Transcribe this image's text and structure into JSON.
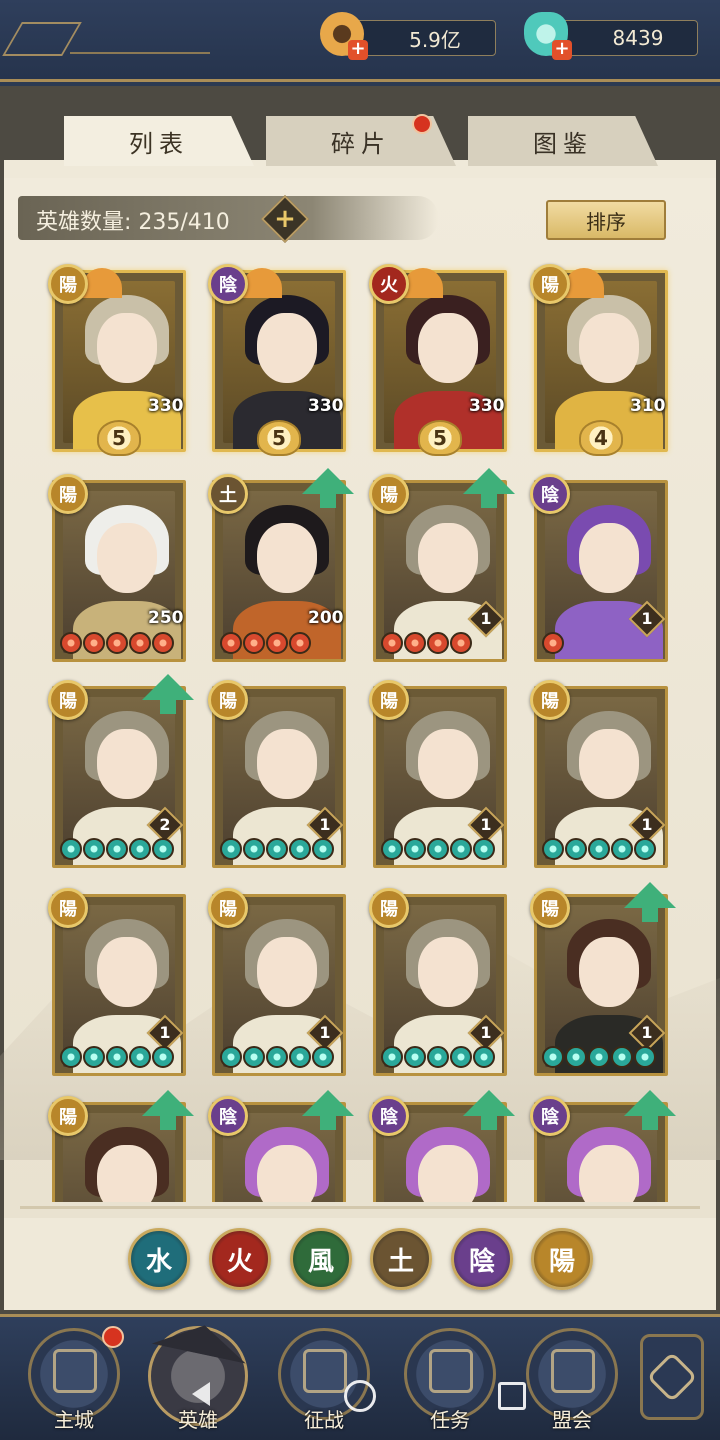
{
  "currencies": [
    {
      "icon": "coin-icon",
      "value": "5.9亿"
    },
    {
      "icon": "jade-pouch-icon",
      "value": "8439"
    }
  ],
  "tabs": [
    {
      "label": "列表",
      "active": true,
      "badge": false
    },
    {
      "label": "碎片",
      "active": false,
      "badge": true
    },
    {
      "label": "图鉴",
      "active": false,
      "badge": false
    }
  ],
  "hero_count": "英雄数量: 235/410",
  "add_label": "+",
  "sort_label": "排序",
  "colors": {
    "yang": "#b8862a",
    "yin": "#6a3f8c",
    "fire": "#a3281e",
    "earth": "#6b5432",
    "water": "#1f6d7a",
    "wind": "#2f6b3a",
    "gem_red": "#d8492e",
    "gem_teal": "#2aa89a",
    "arrow": "#3fb07a"
  },
  "heroes": [
    {
      "element": "陽",
      "badge": "5",
      "level": "330",
      "style": "gold",
      "gems": [],
      "upgrade": false,
      "hair": "#c9c0a8",
      "robe": "#e7c04a"
    },
    {
      "element": "陰",
      "badge": "5",
      "level": "330",
      "style": "gold",
      "gems": [],
      "upgrade": false,
      "hair": "#1c1a24",
      "robe": "#2b2a30"
    },
    {
      "element": "火",
      "badge": "5",
      "level": "330",
      "style": "gold",
      "gems": [],
      "upgrade": false,
      "hair": "#3a2020",
      "robe": "#b0302a"
    },
    {
      "element": "陽",
      "badge": "4",
      "level": "310",
      "style": "gold",
      "gems": [],
      "upgrade": false,
      "hair": "#c9c0a8",
      "robe": "#e0b443"
    },
    {
      "element": "陽",
      "badge": "",
      "level": "250",
      "style": "normal",
      "gems": [
        "red",
        "red",
        "red",
        "red",
        "red"
      ],
      "upgrade": false,
      "hair": "#eeeeea",
      "robe": "#c8b27a"
    },
    {
      "element": "土",
      "badge": "",
      "level": "200",
      "style": "normal",
      "gems": [
        "red",
        "red",
        "red",
        "red"
      ],
      "upgrade": true,
      "hair": "#1e1a1c",
      "robe": "#c0652a"
    },
    {
      "element": "陽",
      "badge": "",
      "level": "1",
      "style": "normal",
      "gems": [
        "red",
        "red",
        "red",
        "red"
      ],
      "upgrade": true,
      "hair": "#9c9580",
      "robe": "#ece6d2"
    },
    {
      "element": "陰",
      "badge": "",
      "level": "1",
      "style": "normal",
      "gems": [
        "red"
      ],
      "upgrade": false,
      "hair": "#7a4bb0",
      "robe": "#8e62c4"
    },
    {
      "element": "陽",
      "badge": "",
      "level": "2",
      "style": "normal",
      "gems": [
        "teal",
        "teal",
        "teal",
        "teal",
        "teal"
      ],
      "upgrade": true,
      "hair": "#9c9580",
      "robe": "#ece6d2"
    },
    {
      "element": "陽",
      "badge": "",
      "level": "1",
      "style": "normal",
      "gems": [
        "teal",
        "teal",
        "teal",
        "teal",
        "teal"
      ],
      "upgrade": false,
      "hair": "#9c9580",
      "robe": "#ece6d2"
    },
    {
      "element": "陽",
      "badge": "",
      "level": "1",
      "style": "normal",
      "gems": [
        "teal",
        "teal",
        "teal",
        "teal",
        "teal"
      ],
      "upgrade": false,
      "hair": "#9c9580",
      "robe": "#ece6d2"
    },
    {
      "element": "陽",
      "badge": "",
      "level": "1",
      "style": "normal",
      "gems": [
        "teal",
        "teal",
        "teal",
        "teal",
        "teal"
      ],
      "upgrade": false,
      "hair": "#9c9580",
      "robe": "#ece6d2"
    },
    {
      "element": "陽",
      "badge": "",
      "level": "1",
      "style": "normal",
      "gems": [
        "teal",
        "teal",
        "teal",
        "teal",
        "teal"
      ],
      "upgrade": false,
      "hair": "#9c9580",
      "robe": "#ece6d2"
    },
    {
      "element": "陽",
      "badge": "",
      "level": "1",
      "style": "normal",
      "gems": [
        "teal",
        "teal",
        "teal",
        "teal",
        "teal"
      ],
      "upgrade": false,
      "hair": "#9c9580",
      "robe": "#ece6d2"
    },
    {
      "element": "陽",
      "badge": "",
      "level": "1",
      "style": "normal",
      "gems": [
        "teal",
        "teal",
        "teal",
        "teal",
        "teal"
      ],
      "upgrade": false,
      "hair": "#9c9580",
      "robe": "#ece6d2"
    },
    {
      "element": "陽",
      "badge": "",
      "level": "1",
      "style": "normal",
      "gems": [
        "teal",
        "teal",
        "teal",
        "teal",
        "teal"
      ],
      "upgrade": true,
      "hair": "#4a2e22",
      "robe": "#2a2a26"
    },
    {
      "element": "陽",
      "badge": "",
      "level": "",
      "style": "normal",
      "gems": [],
      "upgrade": true,
      "hair": "#4a2e22",
      "robe": "#2a2a26"
    },
    {
      "element": "陰",
      "badge": "",
      "level": "",
      "style": "normal",
      "gems": [],
      "upgrade": true,
      "hair": "#b06ac8",
      "robe": "#2c2a4a"
    },
    {
      "element": "陰",
      "badge": "",
      "level": "",
      "style": "normal",
      "gems": [],
      "upgrade": true,
      "hair": "#b06ac8",
      "robe": "#2c2a4a"
    },
    {
      "element": "陰",
      "badge": "",
      "level": "",
      "style": "normal",
      "gems": [],
      "upgrade": true,
      "hair": "#b06ac8",
      "robe": "#2c2a4a"
    }
  ],
  "element_filters": [
    {
      "label": "水",
      "color": "#1f6d7a"
    },
    {
      "label": "火",
      "color": "#a3281e"
    },
    {
      "label": "風",
      "color": "#2f6b3a"
    },
    {
      "label": "土",
      "color": "#6b5432"
    },
    {
      "label": "陰",
      "color": "#6a3f8c"
    },
    {
      "label": "陽",
      "color": "#b8862a"
    }
  ],
  "nav": [
    {
      "label": "主城",
      "icon": "city-gate-icon",
      "badge": true
    },
    {
      "label": "英雄",
      "icon": "hero-portrait-icon",
      "badge": false
    },
    {
      "label": "征战",
      "icon": "war-drum-icon",
      "badge": false
    },
    {
      "label": "任务",
      "icon": "scroll-icon",
      "badge": false
    },
    {
      "label": "盟会",
      "icon": "pavilion-icon",
      "badge": false
    }
  ]
}
